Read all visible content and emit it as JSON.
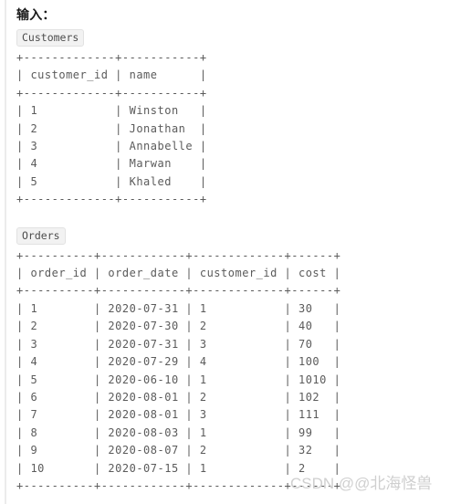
{
  "document": {
    "heading": "输入：",
    "watermark": "CSDN @@北海怪兽"
  },
  "blocks": [
    {
      "badge_label": "Customers",
      "table_text": "+-------------+-----------+\n| customer_id | name      |\n+-------------+-----------+\n| 1           | Winston   |\n| 2           | Jonathan  |\n| 3           | Annabelle |\n| 4           | Marwan    |\n| 5           | Khaled    |\n+-------------+-----------+"
    },
    {
      "badge_label": "Orders",
      "table_text": "+----------+------------+-------------+------+\n| order_id | order_date | customer_id | cost |\n+----------+------------+-------------+------+\n| 1        | 2020-07-31 | 1           | 30   |\n| 2        | 2020-07-30 | 2           | 40   |\n| 3        | 2020-07-31 | 3           | 70   |\n| 4        | 2020-07-29 | 4           | 100  |\n| 5        | 2020-06-10 | 1           | 1010 |\n| 6        | 2020-08-01 | 2           | 102  |\n| 7        | 2020-08-01 | 3           | 111  |\n| 8        | 2020-08-03 | 1           | 99   |\n| 9        | 2020-08-07 | 2           | 32   |\n| 10       | 2020-07-15 | 1           | 2    |\n+----------+------------+-------------+------+"
    }
  ],
  "tables": {
    "customers": {
      "name": "Customers",
      "columns": [
        "customer_id",
        "name"
      ],
      "rows": [
        [
          "1",
          "Winston"
        ],
        [
          "2",
          "Jonathan"
        ],
        [
          "3",
          "Annabelle"
        ],
        [
          "4",
          "Marwan"
        ],
        [
          "5",
          "Khaled"
        ]
      ]
    },
    "orders": {
      "name": "Orders",
      "columns": [
        "order_id",
        "order_date",
        "customer_id",
        "cost"
      ],
      "rows": [
        [
          "1",
          "2020-07-31",
          "1",
          "30"
        ],
        [
          "2",
          "2020-07-30",
          "2",
          "40"
        ],
        [
          "3",
          "2020-07-31",
          "3",
          "70"
        ],
        [
          "4",
          "2020-07-29",
          "4",
          "100"
        ],
        [
          "5",
          "2020-06-10",
          "1",
          "1010"
        ],
        [
          "6",
          "2020-08-01",
          "2",
          "102"
        ],
        [
          "7",
          "2020-08-01",
          "3",
          "111"
        ],
        [
          "8",
          "2020-08-03",
          "1",
          "99"
        ],
        [
          "9",
          "2020-08-07",
          "2",
          "32"
        ],
        [
          "10",
          "2020-07-15",
          "1",
          "2"
        ]
      ]
    }
  },
  "colors": {
    "page_background": "#ffffff",
    "text_mono": "#5b5b5b",
    "heading": "#1a1a1a",
    "badge_background": "#f2f2f2",
    "badge_border": "#e2e2e2",
    "left_rule": "#ececec",
    "watermark": "#cfcfcf"
  }
}
